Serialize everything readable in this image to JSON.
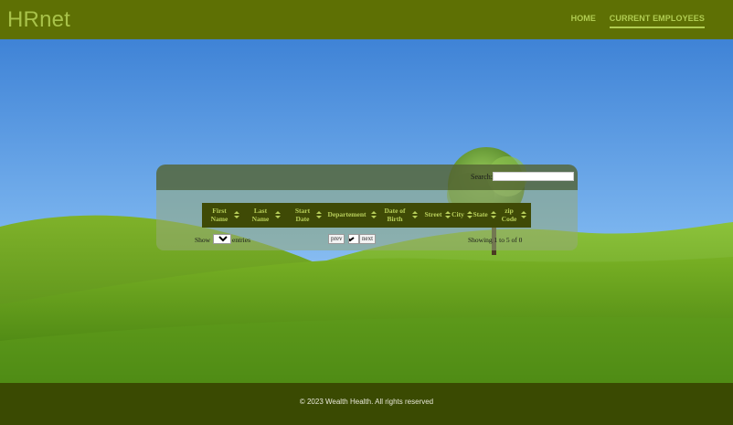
{
  "header": {
    "brand": "HRnet",
    "nav": [
      {
        "label": "HOME"
      },
      {
        "label": "CURRENT EMPLOYEES",
        "active": true
      }
    ]
  },
  "table": {
    "search_label": "Search:",
    "search_value": "",
    "columns": [
      "First Name",
      "Last Name",
      "Start Date",
      "Departement",
      "Date of Birth",
      "Street",
      "City",
      "State",
      "zip Code"
    ],
    "rows": [],
    "show_prefix": "Show",
    "page_size": "5",
    "show_suffix": "entries",
    "prev_label": "prev",
    "next_label": "next",
    "showing_text": "Showing 1 to 5 of 0"
  },
  "footer": {
    "text": "© 2023 Wealth Health. All rights reserved"
  },
  "colors": {
    "header_bg": "#5e7004",
    "brand": "#a8c24a",
    "table_head_bg": "#3f4a06",
    "footer_bg": "#3a4a02"
  },
  "icons": [
    "sort-icon",
    "tree-icon",
    "hills-background"
  ]
}
